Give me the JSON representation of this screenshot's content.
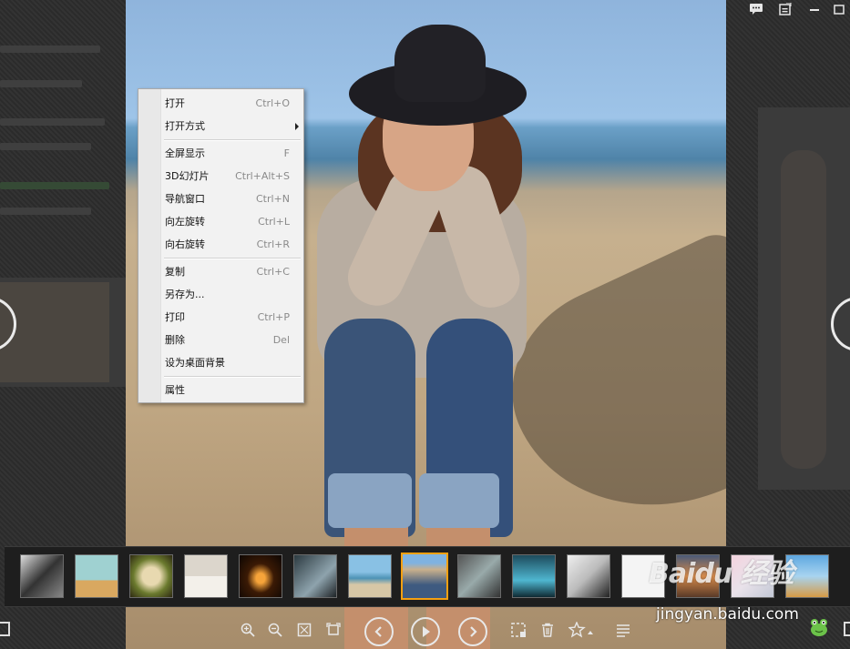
{
  "context_menu": {
    "items": [
      {
        "label": "打开",
        "shortcut": "Ctrl+O"
      },
      {
        "label": "打开方式",
        "shortcut": ""
      },
      {
        "label": "全屏显示",
        "shortcut": "F"
      },
      {
        "label": "3D幻灯片",
        "shortcut": "Ctrl+Alt+S"
      },
      {
        "label": "导航窗口",
        "shortcut": "Ctrl+N"
      },
      {
        "label": "向左旋转",
        "shortcut": "Ctrl+L"
      },
      {
        "label": "向右旋转",
        "shortcut": "Ctrl+R"
      },
      {
        "label": "复制",
        "shortcut": "Ctrl+C"
      },
      {
        "label": "另存为...",
        "shortcut": ""
      },
      {
        "label": "打印",
        "shortcut": "Ctrl+P"
      },
      {
        "label": "删除",
        "shortcut": "Del"
      },
      {
        "label": "设为桌面背景",
        "shortcut": ""
      },
      {
        "label": "属性",
        "shortcut": ""
      }
    ]
  },
  "thumbnails": {
    "count": 15,
    "selected_index": 7
  },
  "toolbar": {
    "icons": [
      "zoom-in-icon",
      "zoom-out-icon",
      "fit-screen-icon",
      "actual-size-icon",
      "previous-icon",
      "play-slideshow-icon",
      "next-icon",
      "crop-icon",
      "delete-icon",
      "favorite-icon",
      "menu-icon"
    ]
  },
  "watermark": {
    "brand": "Baidu 经验",
    "site": "jingyan.baidu.com"
  },
  "colors": {
    "selected_border": "#f5a011",
    "menu_bg": "#f2f2f2",
    "strip_bg": "#1e1e1e"
  }
}
